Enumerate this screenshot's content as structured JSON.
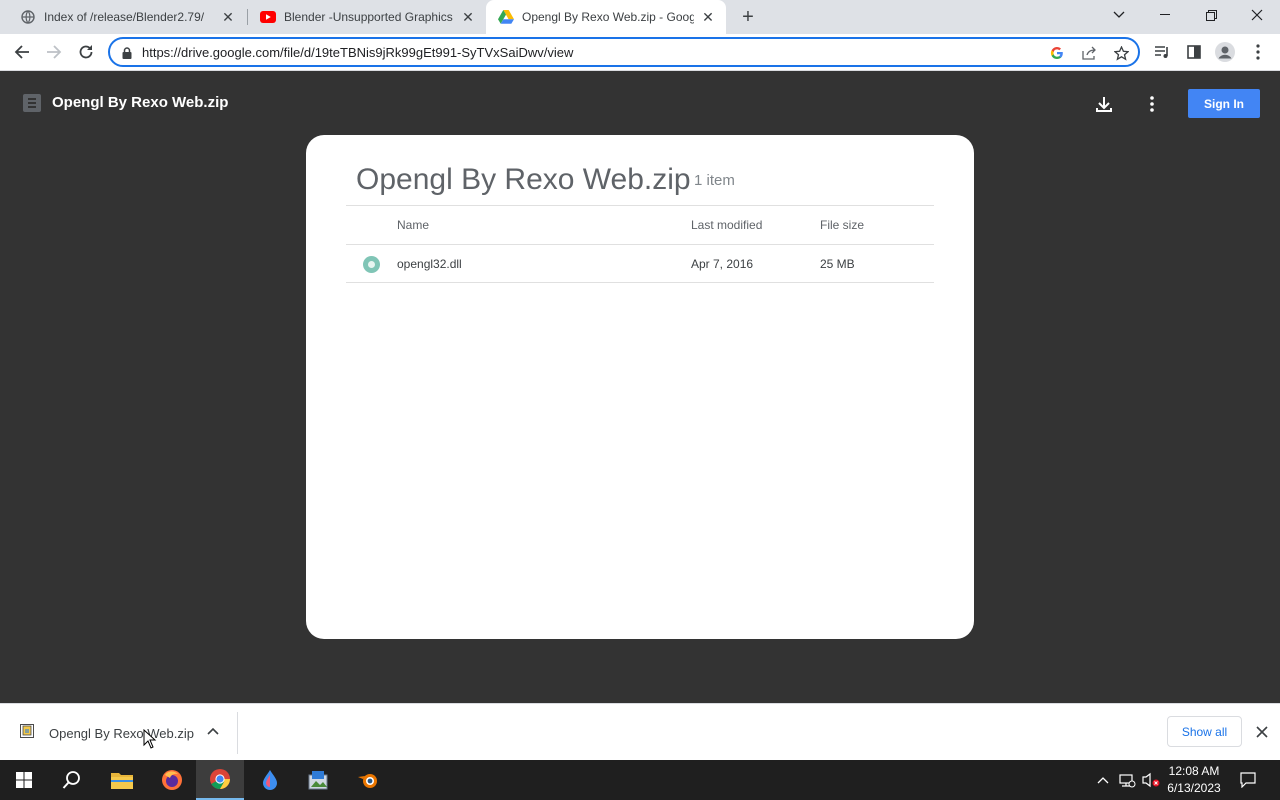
{
  "browser": {
    "tabs": [
      {
        "title": "Index of /release/Blender2.79/",
        "favicon": "globe-icon",
        "active": false
      },
      {
        "title": "Blender -Unsupported Graphics C",
        "favicon": "youtube-icon",
        "active": false
      },
      {
        "title": "Opengl By Rexo Web.zip - Google",
        "favicon": "google-drive-icon",
        "active": true
      }
    ],
    "url": "https://drive.google.com/file/d/19teTBNis9jRk99gEt991-SyTVxSaiDwv/view"
  },
  "viewer": {
    "title": "Opengl By Rexo Web.zip",
    "sign_in_label": "Sign In"
  },
  "archive": {
    "title": "Opengl By Rexo Web.zip",
    "item_count": "1 item",
    "columns": {
      "name": "Name",
      "modified": "Last modified",
      "size": "File size"
    },
    "files": [
      {
        "name": "opengl32.dll",
        "modified": "Apr 7, 2016",
        "size": "25 MB"
      }
    ]
  },
  "download_shelf": {
    "item_name": "Opengl By Rexo Web.zip",
    "show_all_label": "Show all"
  },
  "taskbar": {
    "apps": [
      "start-icon",
      "search-icon",
      "file-explorer-icon",
      "firefox-icon",
      "chrome-icon",
      "krita-drop-icon",
      "image-editor-icon",
      "blender-icon"
    ],
    "time": "12:08 AM",
    "date": "6/13/2023"
  },
  "colors": {
    "accent": "#1a73e8",
    "sign_in_button": "#4285f4",
    "viewer_background": "#333333"
  }
}
